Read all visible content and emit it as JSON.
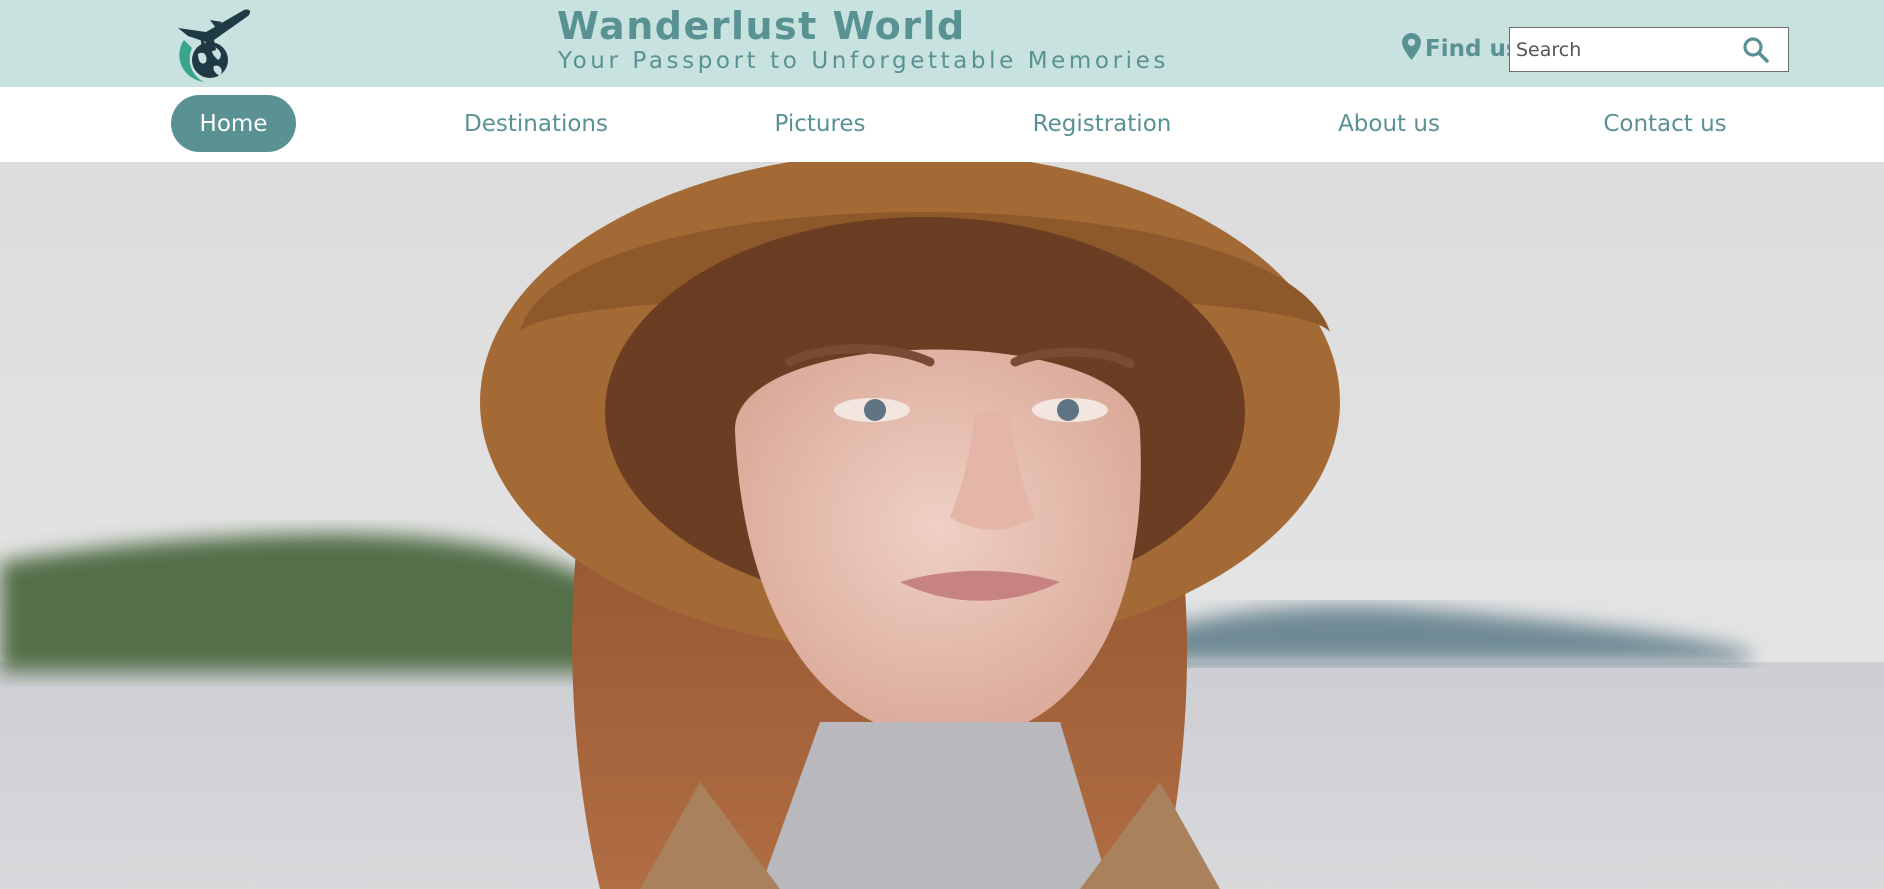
{
  "header": {
    "logo_icon": "airplane-globe-logo-icon",
    "title": "Wanderlust World",
    "tagline": "Your Passport to Unforgettable Memories",
    "find_us": {
      "label": "Find us",
      "icon": "map-marker-icon"
    },
    "search": {
      "placeholder": "Search",
      "value": "",
      "icon": "search-icon"
    }
  },
  "nav": {
    "items": [
      {
        "label": "Home",
        "active": true
      },
      {
        "label": "Destinations",
        "active": false
      },
      {
        "label": "Pictures",
        "active": false
      },
      {
        "label": "Registration",
        "active": false
      },
      {
        "label": "About us",
        "active": false
      },
      {
        "label": "Contact us",
        "active": false
      }
    ]
  },
  "hero": {
    "image": "portrait-woman-brown-hat-lake"
  },
  "colors": {
    "header_bg": "#c7e2df",
    "accent": "#5a9294",
    "nav_bg": "#ffffff",
    "active_text": "#ffffff"
  }
}
